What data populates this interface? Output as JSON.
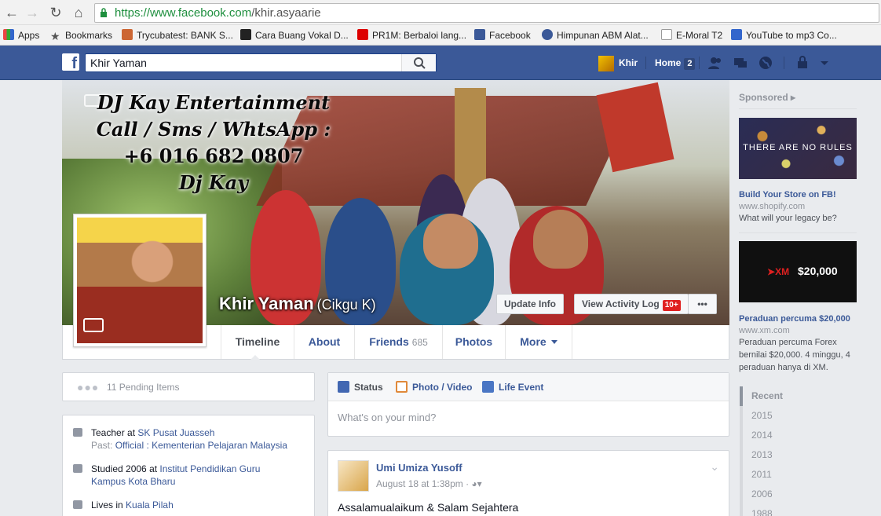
{
  "browser": {
    "url_https": "https://",
    "url_rest_host": "www.facebook.com",
    "url_rest_path": "/khir.asyaarie",
    "bookmarks": [
      {
        "label": "Apps"
      },
      {
        "label": "Bookmarks"
      },
      {
        "label": "Trycubatest: BANK S..."
      },
      {
        "label": "Cara Buang Vokal D..."
      },
      {
        "label": "PR1M: Berbaloi lang..."
      },
      {
        "label": "Facebook"
      },
      {
        "label": "Himpunan ABM Alat..."
      },
      {
        "label": "E-Moral T2"
      },
      {
        "label": "YouTube to mp3 Co..."
      }
    ]
  },
  "topbar": {
    "search_value": "Khir Yaman",
    "profile_name": "Khir",
    "home_label": "Home",
    "home_count": "2"
  },
  "cover": {
    "text_line1": "DJ Kay Entertainment",
    "text_line2": "Call / Sms / WhtsApp :",
    "text_line3": "+6 016 682 0807",
    "text_line4": "Dj Kay",
    "name": "Khir Yaman",
    "alt_name": "(Cikgu K)",
    "update_info": "Update Info",
    "activity_log": "View Activity Log",
    "activity_badge": "10+",
    "more_dots": "•••"
  },
  "tabs": {
    "timeline": "Timeline",
    "about": "About",
    "friends": "Friends",
    "friends_count": "685",
    "photos": "Photos",
    "more": "More"
  },
  "left": {
    "pending": "11 Pending Items",
    "work_prefix": "Teacher at ",
    "work_place": "SK Pusat Juasseh",
    "work_past_prefix": "Past: ",
    "work_past": "Official : Kementerian Pelajaran Malaysia",
    "study_prefix": "Studied 2006 at ",
    "study_place": "Institut Pendidikan Guru Kampus Kota Bharu",
    "lives_prefix": "Lives in ",
    "lives_place": "Kuala Pilah"
  },
  "composer": {
    "status": "Status",
    "photo_video": "Photo / Video",
    "life_event": "Life Event",
    "placeholder": "What's on your mind?"
  },
  "post": {
    "author": "Umi Umiza Yusoff",
    "meta": "August 18 at 1:38pm ·",
    "text": "Assalamualaikum & Salam Sejahtera"
  },
  "sidebar": {
    "sponsored": "Sponsored",
    "ad1_image_text": "THERE ARE NO RULES",
    "ad1_title": "Build Your Store on FB!",
    "ad1_url": "www.shopify.com",
    "ad1_desc": "What will your legacy be?",
    "ad2_logo": "XM",
    "ad2_amount": "$20,000",
    "ad2_title": "Peraduan percuma $20,000",
    "ad2_url": "www.xm.com",
    "ad2_desc": "Peraduan percuma Forex bernilai $20,000. 4 minggu, 4 peraduan hanya di XM.",
    "years": [
      "Recent",
      "2015",
      "2014",
      "2013",
      "2011",
      "2006",
      "1988"
    ]
  },
  "colors": {
    "fb_blue": "#3b5998",
    "link": "#3b5998",
    "badge_red": "#e02020"
  }
}
